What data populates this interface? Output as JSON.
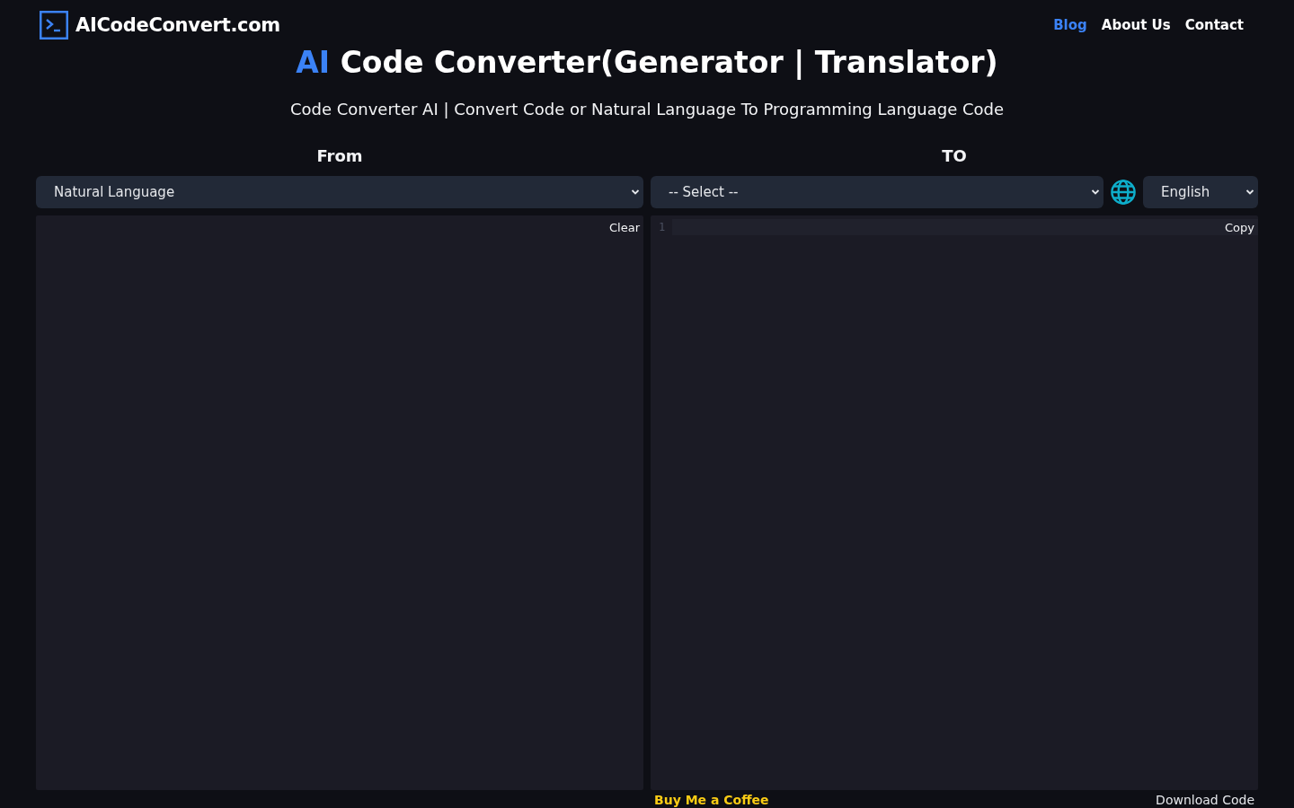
{
  "header": {
    "logo_text": "AICodeConvert.com",
    "nav": [
      {
        "label": "Blog",
        "selected": true
      },
      {
        "label": "About Us",
        "selected": false
      },
      {
        "label": "Contact",
        "selected": false
      }
    ]
  },
  "hero": {
    "title_highlight": "AI",
    "title": "Code Converter(Generator | Translator)",
    "subtitle": "Code Converter AI | Convert Code or Natural Language To Programming Language Code"
  },
  "from_panel": {
    "heading": "From",
    "language_select": {
      "value": "Natural Language"
    },
    "clear_button": "Clear"
  },
  "to_panel": {
    "heading": "TO",
    "language_select": {
      "value": "-- Select --"
    },
    "output_language_select": {
      "value": "English"
    },
    "line_numbers": [
      "1"
    ],
    "copy_button": "Copy",
    "coffee_link": "Buy Me a Coffee",
    "download_button": "Download Code"
  }
}
